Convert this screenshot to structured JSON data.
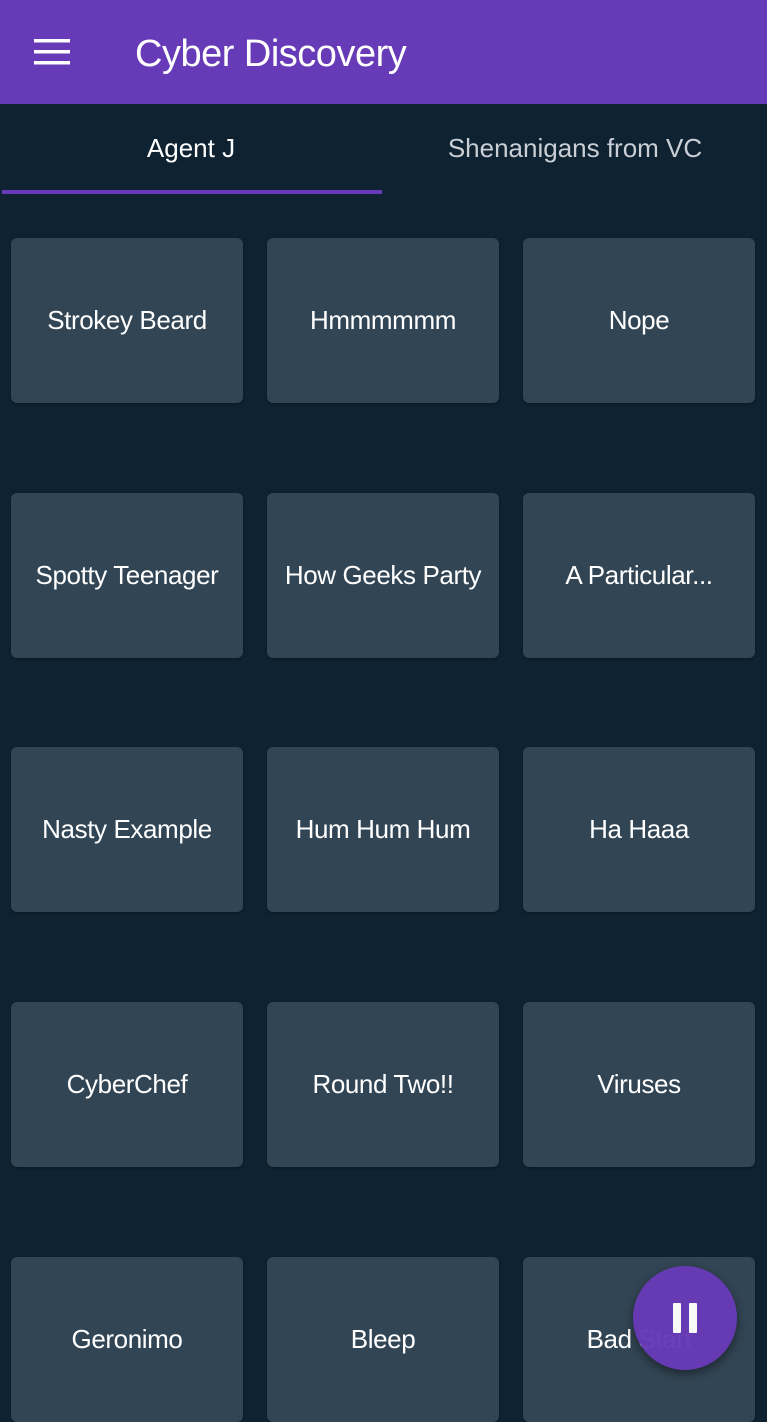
{
  "app_bar": {
    "title": "Cyber Discovery",
    "menu_icon": "menu-icon",
    "background_color": "#673ab7"
  },
  "tabs": [
    {
      "label": "Agent J",
      "selected": true
    },
    {
      "label": "Shenanigans from VC",
      "selected": false
    }
  ],
  "tiles": [
    {
      "label": "Strokey Beard"
    },
    {
      "label": "Hmmmmmm"
    },
    {
      "label": "Nope"
    },
    {
      "label": "Spotty Teenager"
    },
    {
      "label": "How Geeks Party"
    },
    {
      "label": "A Particular..."
    },
    {
      "label": "Nasty Example"
    },
    {
      "label": "Hum Hum Hum"
    },
    {
      "label": "Ha Haaa"
    },
    {
      "label": "CyberChef"
    },
    {
      "label": "Round Two!!"
    },
    {
      "label": "Viruses"
    },
    {
      "label": "Geronimo"
    },
    {
      "label": "Bleep"
    },
    {
      "label": "Bad Start"
    }
  ],
  "fab": {
    "icon": "pause-icon",
    "color": "#673ab7"
  },
  "colors": {
    "background": "#0f2231",
    "tile": "#324554",
    "accent": "#673ab7"
  }
}
